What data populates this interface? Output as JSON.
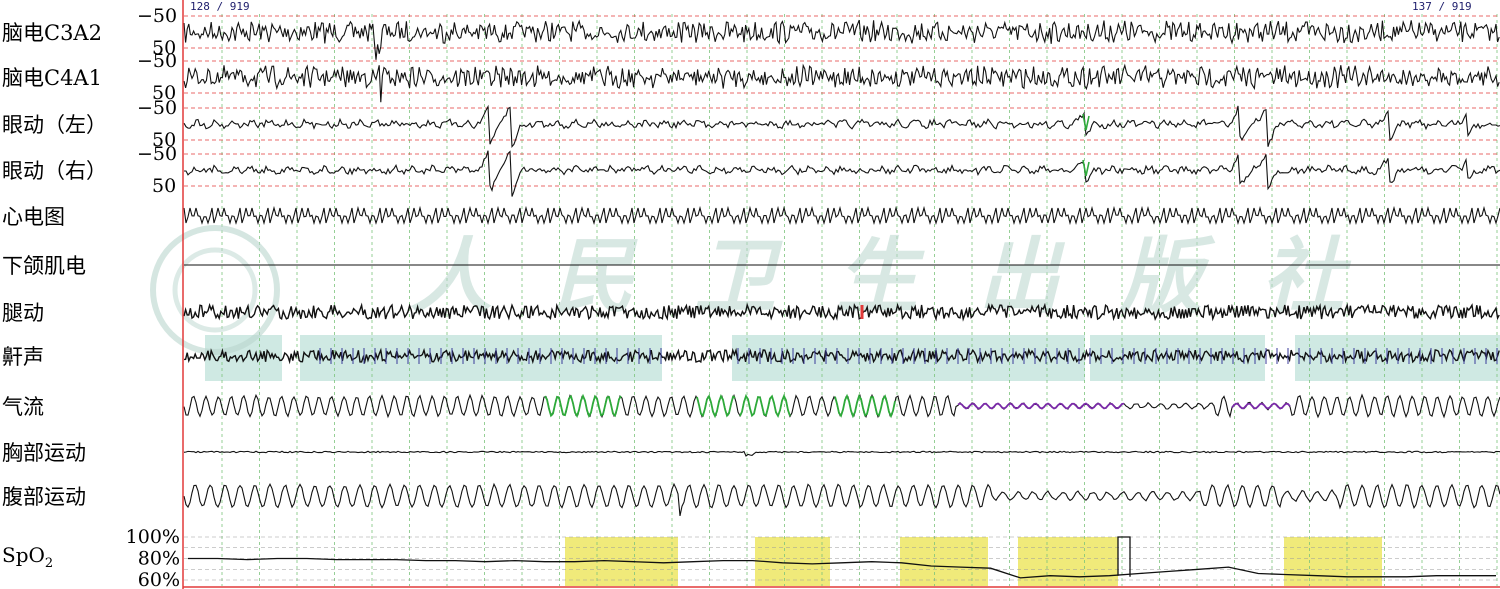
{
  "chart_data": {
    "type": "line",
    "title": "",
    "epoch_left": "128 / 919",
    "epoch_right": "137 / 919",
    "watermark": "人民卫生出版社",
    "channels": [
      {
        "label": "脑电C3A2",
        "scale_top": "−50",
        "scale_bottom": "50",
        "kind": "eeg"
      },
      {
        "label": "脑电C4A1",
        "scale_top": "−50",
        "scale_bottom": "50",
        "kind": "eeg"
      },
      {
        "label": "眼动（左）",
        "scale_top": "−50",
        "scale_bottom": "50",
        "kind": "eog"
      },
      {
        "label": "眼动（右）",
        "scale_top": "−50",
        "scale_bottom": "50",
        "kind": "eog"
      },
      {
        "label": "心电图",
        "kind": "ecg"
      },
      {
        "label": "下颌肌电",
        "kind": "flat"
      },
      {
        "label": "腿动",
        "kind": "emg"
      },
      {
        "label": "鼾声",
        "kind": "snore"
      },
      {
        "label": "气流",
        "kind": "airflow"
      },
      {
        "label": "胸部运动",
        "kind": "flat_noise"
      },
      {
        "label": "腹部运动",
        "kind": "effort"
      }
    ],
    "spo2": {
      "label": "SpO",
      "label_sub": "2",
      "ticks": [
        "100%",
        "80%",
        "60%"
      ],
      "ylim": [
        60,
        100
      ],
      "values": [
        80,
        80,
        79,
        80,
        80,
        79,
        79,
        79,
        78,
        78,
        77,
        78,
        77,
        77,
        78,
        77,
        76,
        77,
        78,
        78,
        76,
        75,
        76,
        77,
        76,
        73,
        72,
        71,
        62,
        64,
        63,
        64,
        66,
        68,
        70,
        72,
        66,
        65,
        64,
        63,
        63,
        63,
        64,
        64,
        64
      ],
      "desaturation_events": 6,
      "event_color": "#f0ea7a"
    },
    "colors": {
      "trace": "#111111",
      "scale_line": "#e23a3a",
      "grid": "#7cc47c",
      "airflow_events": "#2eaa3a",
      "hypopnea_events": "#7a2aa8",
      "snore_mark": "#3a3a9a",
      "snore_band": "#bfe2da",
      "leg_event": "#e23a3a"
    }
  }
}
